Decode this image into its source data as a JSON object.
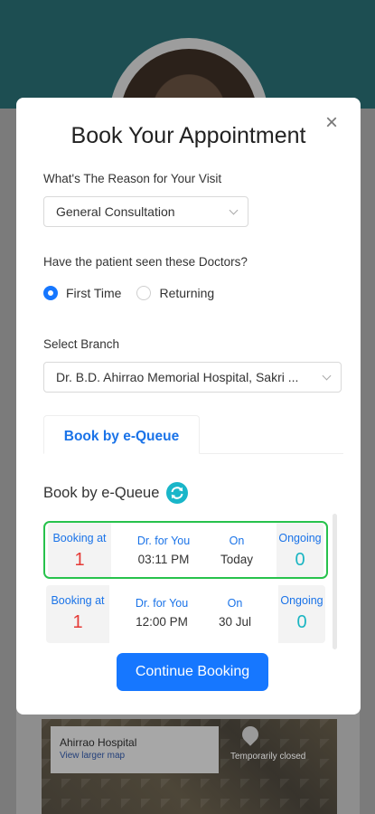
{
  "modal": {
    "title": "Book Your Appointment",
    "close_glyph": "×",
    "visit_reason": {
      "label": "What's The Reason for Your Visit",
      "selected": "General Consultation"
    },
    "patient_seen": {
      "label": "Have the patient seen these Doctors?",
      "options": [
        {
          "label": "First Time",
          "checked": true
        },
        {
          "label": "Returning",
          "checked": false
        }
      ]
    },
    "branch": {
      "label": "Select Branch",
      "selected": "Dr. B.D. Ahirrao Memorial Hospital, Sakri ..."
    },
    "tab": {
      "label": "Book by e-Queue"
    },
    "equeue": {
      "title": "Book by e-Queue",
      "refresh_icon": "refresh-icon",
      "slots": [
        {
          "booking_label": "Booking at",
          "booking_value": "1",
          "doctor_label": "Dr. for You",
          "doctor_time": "03:11 PM",
          "on_label": "On",
          "on_value": "Today",
          "ongoing_label": "Ongoing",
          "ongoing_value": "0",
          "selected": true
        },
        {
          "booking_label": "Booking at",
          "booking_value": "1",
          "doctor_label": "Dr. for You",
          "doctor_time": "12:00 PM",
          "on_label": "On",
          "on_value": "30 Jul",
          "ongoing_label": "Ongoing",
          "ongoing_value": "0",
          "selected": false
        }
      ]
    },
    "continue_label": "Continue Booking"
  },
  "background": {
    "map_title": "Ahirrao Hospital",
    "map_link": "View larger map",
    "map_pin_label": "Temporarily closed"
  },
  "colors": {
    "accent": "#1677ff",
    "selected_border": "#27c24c",
    "booking_number": "#e53935",
    "ongoing_number": "#1ab5c2"
  }
}
